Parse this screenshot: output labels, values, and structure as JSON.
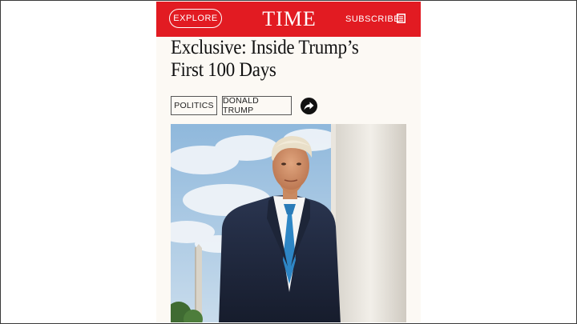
{
  "header": {
    "explore_label": "EXPLORE",
    "logo": "TIME",
    "subscribe_label": "SUBSCRIBE",
    "brand_color": "#e21b22"
  },
  "article": {
    "headline_line1": "Exclusive: Inside Trump’s",
    "headline_line2": "First 100 Days",
    "tags": [
      "POLITICS",
      "DONALD TRUMP"
    ],
    "share_icon": "share-arrow-icon"
  }
}
